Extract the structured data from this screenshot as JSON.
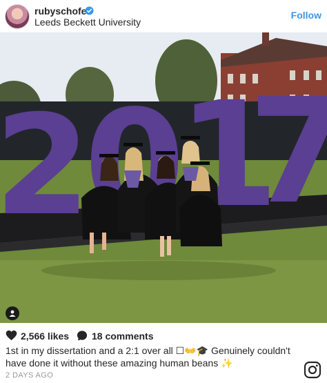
{
  "post": {
    "username": "rubyschofe",
    "location": "Leeds Beckett University",
    "follow_label": "Follow",
    "likes": "2,566 likes",
    "comments": "18 comments",
    "caption_text": "1st in my dissertation and a 2:1 over all ☐👐🎓 Genuinely couldn't have done it without these amazing human beans ✨",
    "timestamp": "2 DAYS AGO"
  },
  "photo": {
    "scene_numerals": [
      "2",
      "0",
      "1",
      "7"
    ]
  },
  "icons": {
    "verified": "verified-badge-icon",
    "tag": "person-tag-icon",
    "like": "heart-icon",
    "comment": "comment-bubble-icon",
    "brand": "instagram-logo-icon"
  },
  "colors": {
    "accent": "#3897f0",
    "numerals": "#5a3f93",
    "grass": "#6f8a3a",
    "text": "#262626",
    "muted": "#999999"
  }
}
